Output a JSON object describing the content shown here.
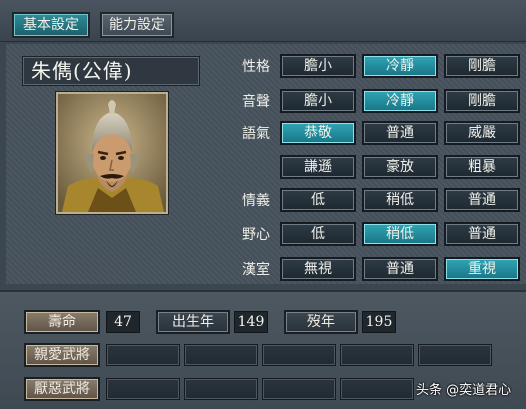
{
  "tabs": {
    "basic": "基本設定",
    "ability": "能力設定"
  },
  "character": {
    "name": "朱儁(公偉)"
  },
  "traits": [
    {
      "label": "性格",
      "options": [
        "膽小",
        "冷靜",
        "剛膽"
      ],
      "selected": 1
    },
    {
      "label": "音聲",
      "options": [
        "膽小",
        "冷靜",
        "剛膽"
      ],
      "selected": 1
    },
    {
      "label": "語氣",
      "options": [
        "恭敬",
        "普通",
        "威嚴"
      ],
      "selected": 0
    },
    {
      "label": "",
      "options": [
        "謙遜",
        "豪放",
        "粗暴"
      ],
      "selected": -1
    },
    {
      "label": "情義",
      "options": [
        "低",
        "稍低",
        "普通"
      ],
      "selected": -1
    },
    {
      "label": "野心",
      "options": [
        "低",
        "稍低",
        "普通"
      ],
      "selected": 1
    },
    {
      "label": "漢室",
      "options": [
        "無視",
        "普通",
        "重視"
      ],
      "selected": 2
    }
  ],
  "stats": {
    "lifespan_label": "壽命",
    "lifespan": "47",
    "birth_label": "出生年",
    "birth": "149",
    "death_label": "歿年",
    "death": "195"
  },
  "relations": {
    "favored_label": "親愛武將",
    "disliked_label": "厭惡武將"
  },
  "watermark": "头条 @奕道君心",
  "colors": {
    "selected": "#2fa5b5",
    "panel": "#46525c",
    "brown_button": "#8a7d6c"
  }
}
